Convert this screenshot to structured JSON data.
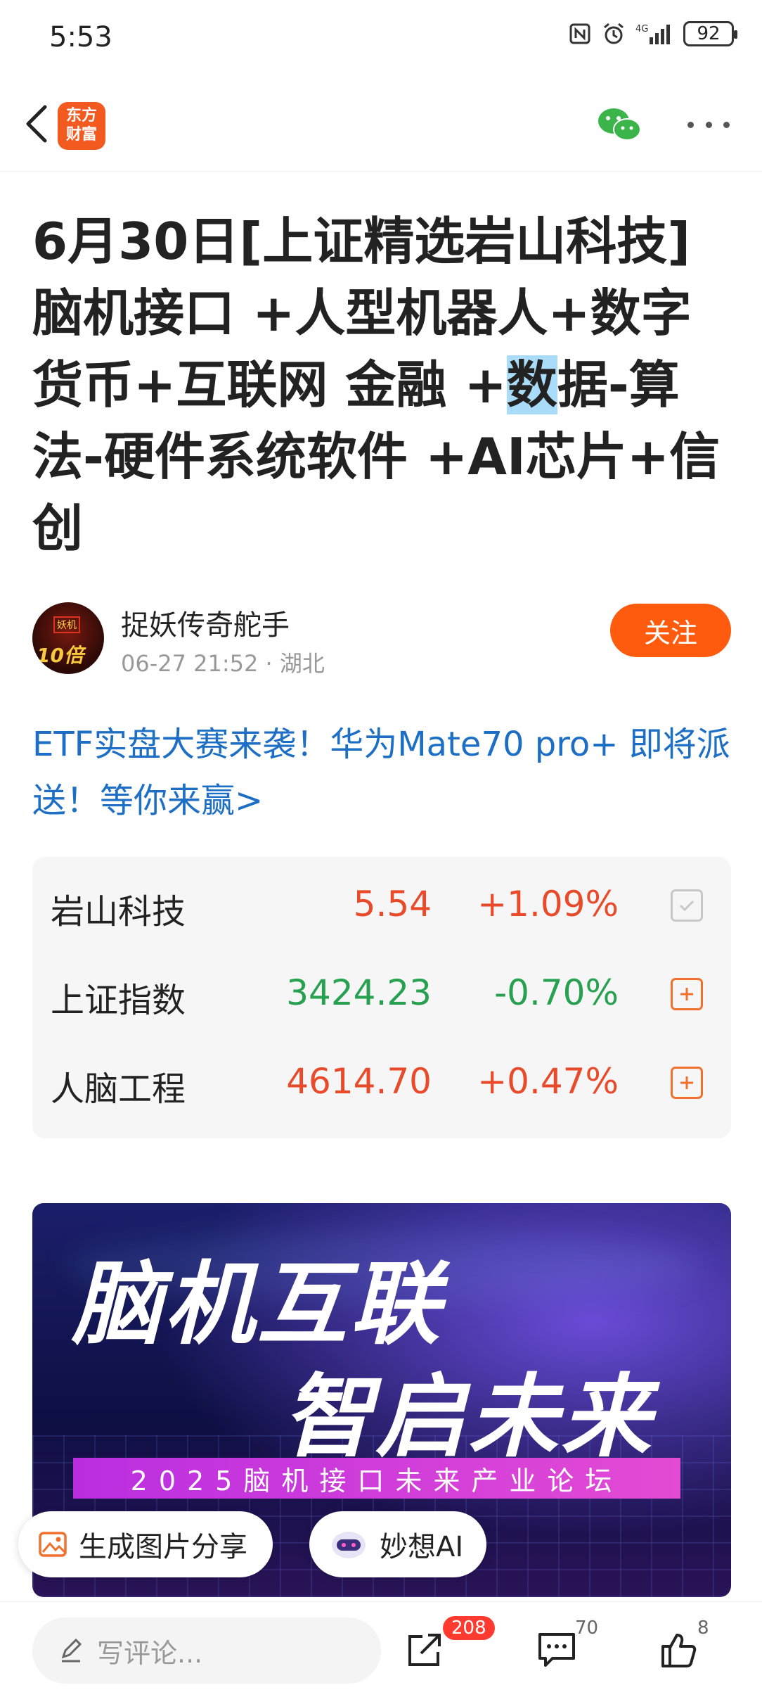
{
  "status_bar": {
    "time": "5:53",
    "network": "4G",
    "battery": "92"
  },
  "header": {
    "logo_text": "东方\n财富"
  },
  "article": {
    "title_parts": [
      "6月30日[上证精选岩山科技]脑机接口 +人型机器人+数字货币+互联网 金融 +",
      "数",
      "据-算法-硬件系统软件 +AI芯片+信创"
    ],
    "author_name": "捉妖传奇舵手",
    "meta": "06-27 21:52 · 湖北",
    "follow_label": "关注",
    "avatar_text_top": "妖机",
    "avatar_text_bottom": "10倍"
  },
  "promo_text": "ETF实盘大赛来袭！华为Mate70 pro+ 即将派送！等你来赢>",
  "stocks": [
    {
      "name": "岩山科技",
      "price": "5.54",
      "change": "+1.09%",
      "trend": "up",
      "action": "checked"
    },
    {
      "name": "上证指数",
      "price": "3424.23",
      "change": "-0.70%",
      "trend": "down",
      "action": "add"
    },
    {
      "name": "人脑工程",
      "price": "4614.70",
      "change": "+0.47%",
      "trend": "up",
      "action": "add"
    }
  ],
  "banner": {
    "line1": "脑机互联",
    "line2": "智启未来",
    "strip": "2025脑机接口未来产业论坛"
  },
  "floating": {
    "share_label": "生成图片分享",
    "ai_label": "妙想AI"
  },
  "bottom_bar": {
    "comment_placeholder": "写评论...",
    "share_count": "208",
    "comment_count": "70",
    "like_count": "8"
  },
  "colors": {
    "accent": "#ff5b0f",
    "up": "#e84a2a",
    "down": "#27a150",
    "link": "#1d6ec5"
  }
}
